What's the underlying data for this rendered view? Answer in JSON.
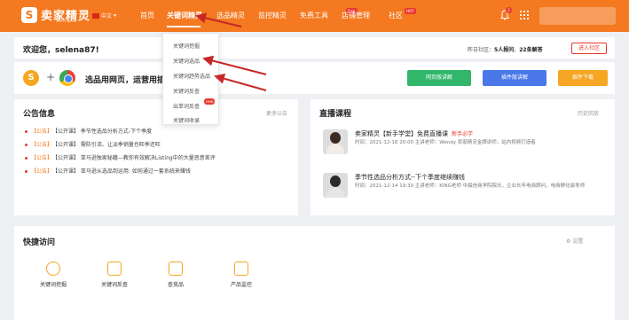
{
  "brand": {
    "logo_glyph": "S",
    "name": "卖家精灵",
    "subtitle": "SellerSprite",
    "lang": "中文"
  },
  "nav": {
    "items": [
      "首页",
      "关键词精灵",
      "选品精灵",
      "监控精灵",
      "免费工具",
      "店铺管理",
      "社区"
    ],
    "active": "关键词精灵",
    "free_tag": "Free",
    "hot_tag": "HOT"
  },
  "notifications": {
    "count": "2"
  },
  "dropdown": {
    "items": [
      "关键词挖掘",
      "关键词选品",
      "关键词趋势选品",
      "关键词反查",
      "出单词反查",
      "关键词收录"
    ],
    "new_tag": "new"
  },
  "welcome": {
    "greeting": "欢迎您，selena87!",
    "community_label": "昨日社区：",
    "joined": "5人报问",
    "posts": "22条解答",
    "join_button": "进入社区"
  },
  "plugin": {
    "text": "选品用网页，运营用插",
    "buttons": [
      "网页版讲解",
      "插件版讲解",
      "插件下载"
    ]
  },
  "notice": {
    "title": "公告信息",
    "more": "更多公告",
    "tag": "【公告】",
    "items": [
      "【公开课】 季节性选品分析方式-下个季度",
      "【公开课】 需防引流、让淡季销量也旺季还旺",
      "【公开课】 亚马逊独家秘籍—教你有效解决Listing中的大量恶意差评",
      "【公开课】 亚马逊从选品到运用: 如何通过一套系统来赚钱"
    ]
  },
  "live": {
    "title": "直播课程",
    "more": "历史回放",
    "courses": [
      {
        "title": "卖家精灵【新手学堂】免费直播课",
        "badge": "新手必学",
        "meta": "时间：2021-12-16 20:00   主讲老师：Wendy 卖家精灵金牌讲师，站内视频打造者"
      },
      {
        "title": "季节性选品分析方式--下个季度继续赚钱",
        "badge": "",
        "meta": "时间：2021-12-14 19:30   主讲老师：KING老师 中晨信商学院院长，企业长年电商顾问，电商孵化级导师"
      }
    ]
  },
  "quick": {
    "title": "快捷访问",
    "settings": "设置",
    "items": [
      "关键词挖掘",
      "关键词反查",
      "查竞品",
      "产品监控"
    ]
  },
  "colors": {
    "brand": "#f47920",
    "red": "#e8382d",
    "green": "#31b66b",
    "blue": "#4a78e8",
    "amber": "#f5a623"
  }
}
